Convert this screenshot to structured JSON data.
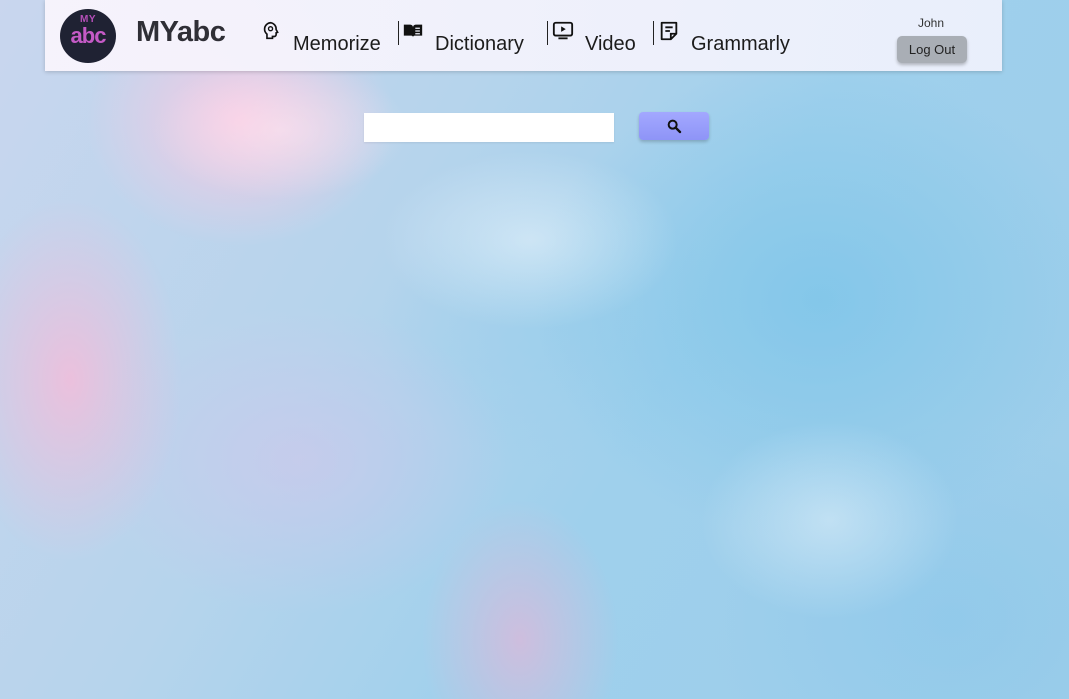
{
  "header": {
    "logo": {
      "top_text": "MY",
      "main_text": "abc"
    },
    "brand_name": "MYabc",
    "nav": [
      {
        "label": "Memorize",
        "icon": "brain-head-icon"
      },
      {
        "label": "Dictionary",
        "icon": "open-book-icon"
      },
      {
        "label": "Video",
        "icon": "video-play-icon"
      },
      {
        "label": "Grammarly",
        "icon": "note-icon"
      }
    ],
    "user": {
      "name": "John",
      "logout_label": "Log Out"
    }
  },
  "search": {
    "value": "",
    "placeholder": "",
    "button_icon": "search-icon"
  },
  "colors": {
    "search_button": "#9ba0fb",
    "logout_button": "#a9aeb5",
    "logo_bg": "#1f2233",
    "logo_text": "#c45ac6"
  }
}
